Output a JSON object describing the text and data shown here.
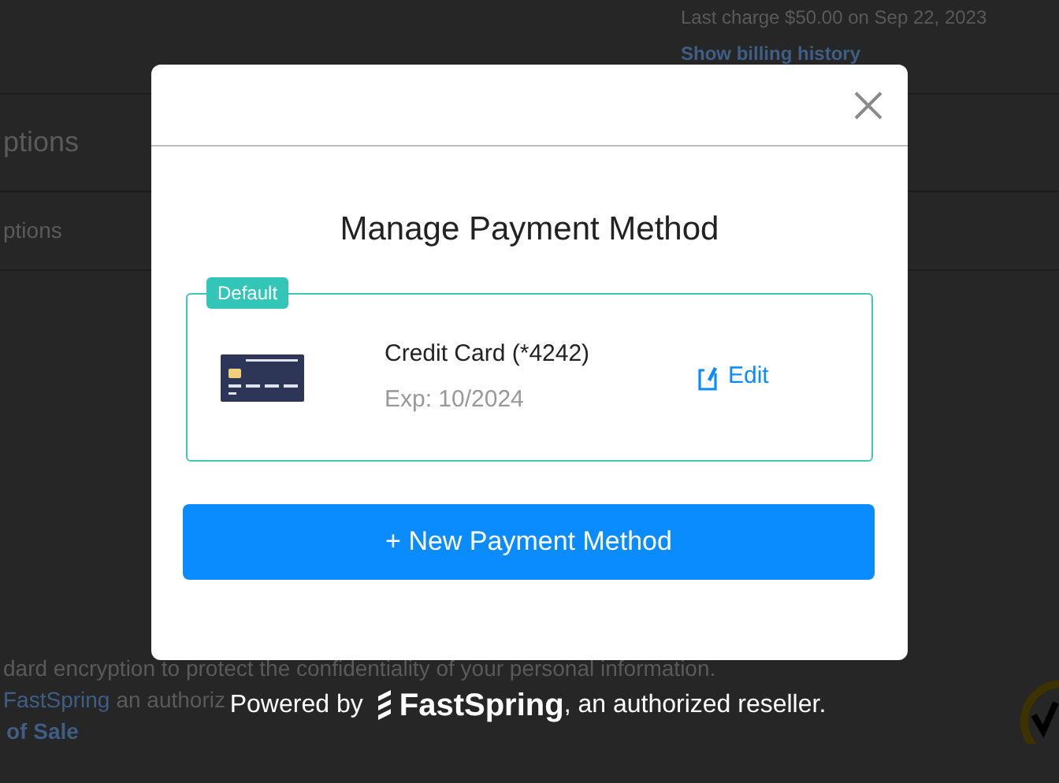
{
  "background": {
    "last_charge": "Last charge $50.00 on Sep 22, 2023",
    "billing_link": "Show billing history",
    "section_heading": "ptions",
    "section_item": "ptions",
    "notice": "dard encryption to protect the confidentiality of your personal information.",
    "reseller_link": "FastSpring",
    "reseller_text": "an authoriz",
    "terms_link": "of Sale"
  },
  "modal": {
    "title": "Manage Payment Method",
    "methods": [
      {
        "badge": "Default",
        "default": true,
        "name": "Credit Card (*4242)",
        "expiry": "Exp: 10/2024",
        "action": "Edit"
      }
    ],
    "new_button": "+ New Payment Method"
  },
  "footer": {
    "prefix": "Powered by",
    "brand": "FastSpring",
    "suffix": ", an authorized reseller."
  }
}
